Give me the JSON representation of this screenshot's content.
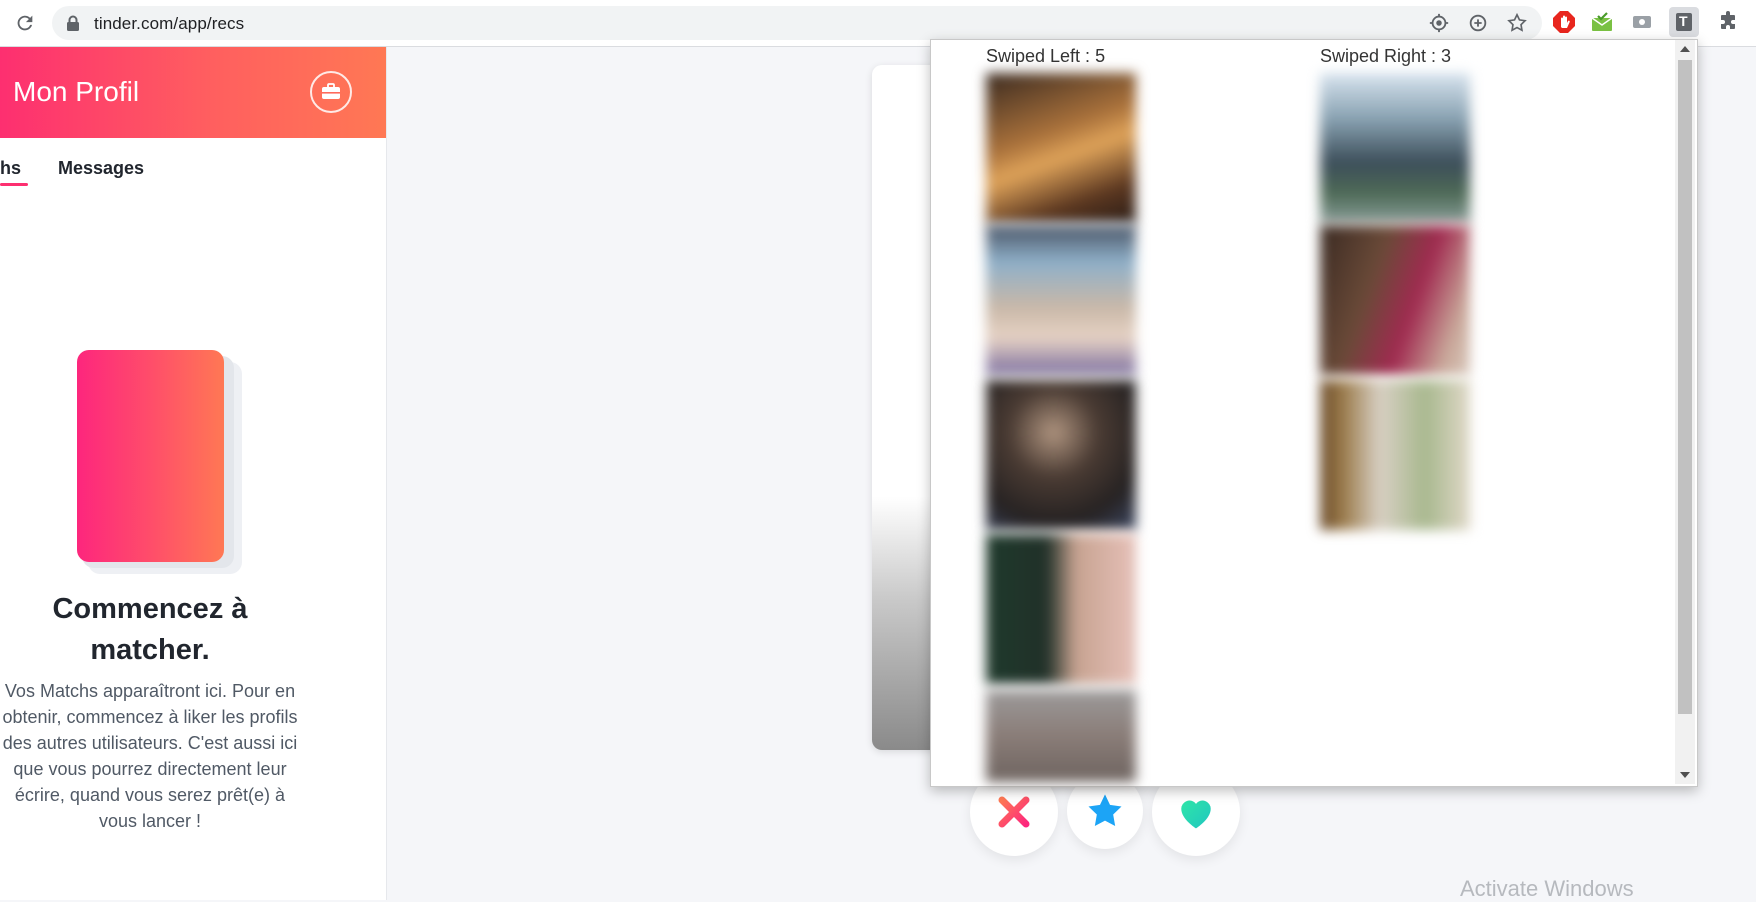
{
  "browser": {
    "url": "tinder.com/app/recs",
    "icons": [
      "reload-icon",
      "lock-icon",
      "location-icon",
      "zoom-icon",
      "star-icon",
      "adblock-icon",
      "mail-ext-icon",
      "screen-ext-icon",
      "t-ext-icon",
      "puzzle-icon"
    ],
    "t_ext_letter": "T"
  },
  "sidebar": {
    "header_title": "Mon Profil",
    "tabs": [
      {
        "label": "hs",
        "active": true
      },
      {
        "label": "Messages",
        "active": false
      }
    ],
    "empty_title": "Commencez à matcher.",
    "empty_desc": "Vos Matchs apparaîtront ici. Pour en obtenir, commencez à liker les profils des autres utilisateurs. C'est aussi ici que vous pourrez directement leur écrire, quand vous serez prêt(e) à vous lancer !"
  },
  "actions": {
    "nope": "close-icon",
    "super_like": "star-icon",
    "like": "heart-icon"
  },
  "popup": {
    "left_label": "Swiped Left : 5",
    "right_label": "Swiped Right : 3",
    "left_count": 5,
    "right_count": 3
  },
  "watermark": "Activate Windows",
  "colors": {
    "brand_start": "#fd2f70",
    "brand_end": "#ff7854",
    "nope": "#fd5068",
    "star": "#1ca4f6",
    "like": "#2ee6a8"
  }
}
